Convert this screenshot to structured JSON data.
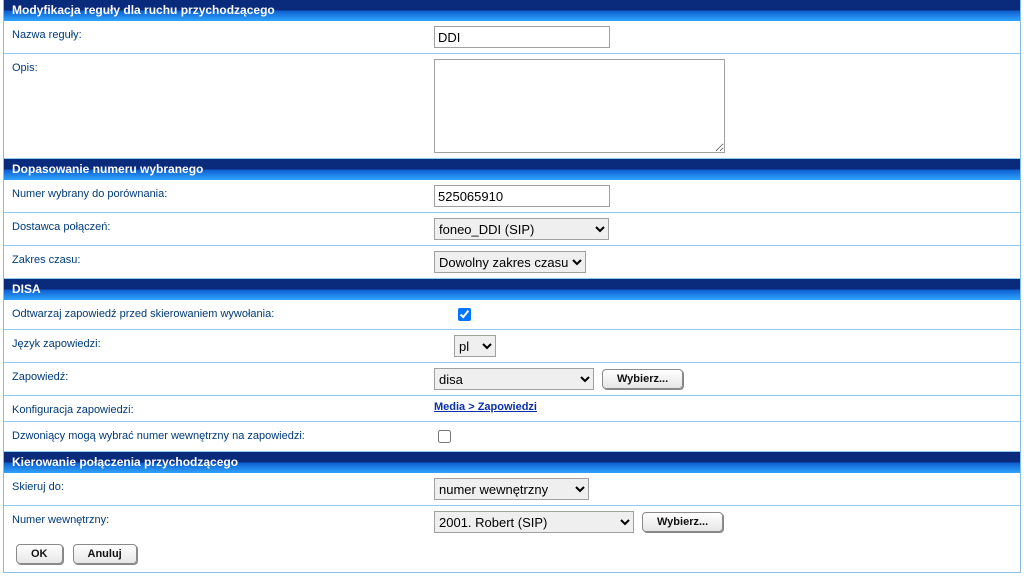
{
  "sections": {
    "mod": {
      "title": "Modyfikacja reguły dla ruchu przychodzącego",
      "rule_name_label": "Nazwa reguły:",
      "rule_name_value": "DDI",
      "desc_label": "Opis:",
      "desc_value": ""
    },
    "match": {
      "title": "Dopasowanie numeru wybranego",
      "dialed_label": "Numer wybrany do porównania:",
      "dialed_value": "525065910",
      "provider_label": "Dostawca połączeń:",
      "provider_value": "foneo_DDI (SIP)",
      "time_label": "Zakres czasu:",
      "time_value": "Dowolny zakres czasu"
    },
    "disa": {
      "title": "DISA",
      "play_label": "Odtwarzaj zapowiedź przed skierowaniem wywołania:",
      "play_checked": true,
      "lang_label": "Język zapowiedzi:",
      "lang_value": "pl",
      "ann_label": "Zapowiedź:",
      "ann_value": "disa",
      "select_btn": "Wybierz...",
      "config_label": "Konfiguracja zapowiedzi:",
      "config_link": "Media > Zapowiedzi",
      "callers_label": "Dzwoniący mogą wybrać numer wewnętrzny na zapowiedzi:",
      "callers_checked": false
    },
    "route": {
      "title": "Kierowanie połączenia przychodzącego",
      "target_label": "Skieruj do:",
      "target_value": "numer wewnętrzny",
      "ext_label": "Numer wewnętrzny:",
      "ext_value": "2001. Robert (SIP)",
      "select_btn": "Wybierz..."
    }
  },
  "buttons": {
    "ok": "OK",
    "cancel": "Anuluj"
  }
}
